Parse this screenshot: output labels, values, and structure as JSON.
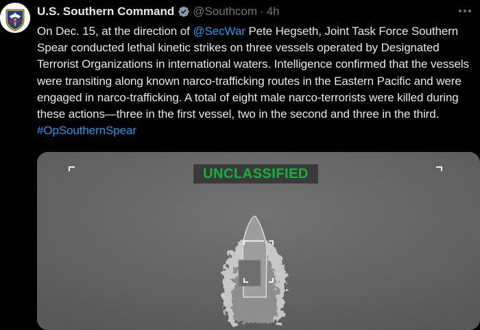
{
  "author": {
    "display_name": "U.S. Southern Command",
    "handle": "@Southcom",
    "separator": "·",
    "timestamp": "4h"
  },
  "tweet": {
    "text_1": "On Dec. 15, at the direction of ",
    "mention": "@SecWar",
    "text_2": " Pete Hegseth, Joint Task Force Southern Spear conducted lethal kinetic strikes on three vessels operated by Designated Terrorist Organizations in international waters. Intelligence confirmed that the vessels were transiting along known narco-trafficking routes in the Eastern Pacific and were engaged in narco-trafficking. A total of eight male narco-terrorists were killed during these actions—three in the first vessel, two in the second and three in the third. ",
    "hashtag": "#OpSouthernSpear"
  },
  "media": {
    "banner_text": "UNCLASSIFIED"
  },
  "icons": {
    "verified": "verified-badge-icon",
    "more": "more-options-icon",
    "avatar": "southcom-seal"
  },
  "colors": {
    "background": "#000000",
    "text": "#e7e9ea",
    "muted": "#71767b",
    "link": "#1d9bf0",
    "banner_green": "#12b43a"
  }
}
